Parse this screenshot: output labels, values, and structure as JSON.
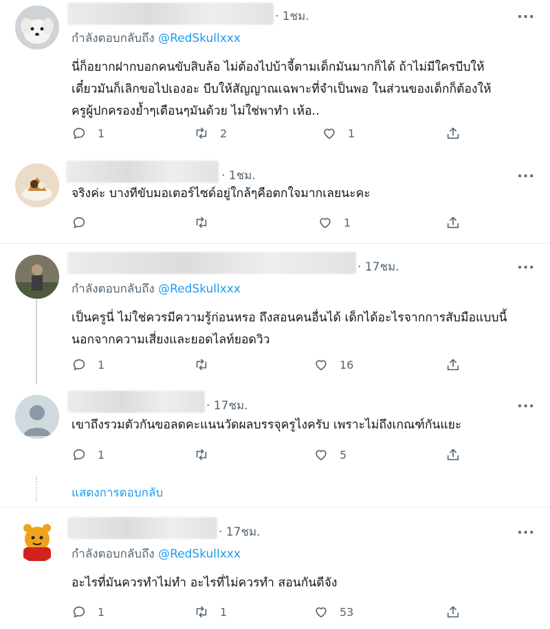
{
  "tweets": [
    {
      "time": "· 1ชม.",
      "replying_prefix": "กำลังตอบกลับถึง",
      "replying_handle": "@RedSkullxxx",
      "lines": [
        "นี่ก็อยากฝากบอกคนขับสิบล้อ ไม่ต้องไปบ้าจี้ตามเด็กมันมากก็ได้ ถ้าไม่มีใครบีบให้",
        "เดี๋ยวมันก็เลิกขอไปเองอะ บีบให้สัญญาณเฉพาะที่จำเป็นพอ ในส่วนของเด็กก็ต้องให้",
        "ครูผู้ปกครองย้ำๆเตือนๆมันด้วย ไม่ใช่พาทำ เห้อ.."
      ],
      "replies": "1",
      "retweets": "2",
      "likes": "1"
    },
    {
      "time": "· 1ชม.",
      "lines": [
        "จริงค่ะ บางทีขับมอเตอร์ไซด์อยู่ใกล้ๆคือตกใจมากเลยนะคะ"
      ],
      "replies": "",
      "retweets": "",
      "likes": "1"
    },
    {
      "time": "· 17ชม.",
      "replying_prefix": "กำลังตอบกลับถึง",
      "replying_handle": "@RedSkullxxx",
      "lines": [
        "เป็นครูนี่ ไม่ใช่ควรมีความรู้ก่อนหรอ ถึงสอนคนอื่นได้ เด็กได้อะไรจากการสับมือแบบนี้",
        "นอกจากความเสี่ยงและยอดไลท์ยอดวิว"
      ],
      "replies": "1",
      "retweets": "",
      "likes": "16"
    },
    {
      "time": "· 17ชม.",
      "lines": [
        "เขาถึงรวมตัวกันขอลดคะแนนวัดผลบรรจุครูไงครับ เพราะไม่ถึงเกณฑ์กันแยะ"
      ],
      "replies": "1",
      "retweets": "",
      "likes": "5"
    },
    {
      "time": "· 17ชม.",
      "replying_prefix": "กำลังตอบกลับถึง",
      "replying_handle": "@RedSkullxxx",
      "lines": [
        "อะไรที่มันควรทำไม่ทำ อะไรที่ไม่ควรทำ สอนกันดีจัง"
      ],
      "replies": "1",
      "retweets": "1",
      "likes": "53"
    }
  ],
  "show_replies_label": "แสดงการตอบกลับ",
  "more_label": "···",
  "icons": {
    "reply": "reply-icon",
    "retweet": "retweet-icon",
    "like": "heart-icon",
    "share": "share-icon",
    "more": "more-icon"
  },
  "colors": {
    "link": "#1d9bf0",
    "muted": "#536471",
    "text": "#0f1419",
    "divider": "#e6ecf0"
  }
}
